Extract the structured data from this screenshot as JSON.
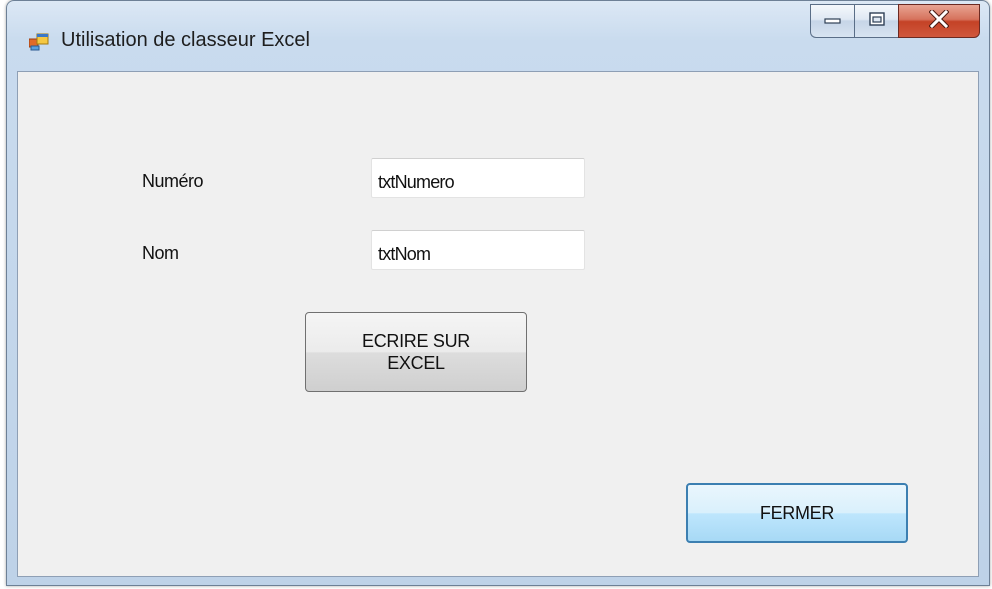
{
  "window": {
    "title": "Utilisation de classeur Excel",
    "icon": "windows-form-icon"
  },
  "caption_buttons": {
    "minimize_icon": "minimize-icon",
    "maximize_icon": "maximize-icon",
    "close_icon": "close-icon"
  },
  "form": {
    "numero_label": "Numéro",
    "numero_value": "txtNumero",
    "nom_label": "Nom",
    "nom_value": "txtNom",
    "write_button_label": "ECRIRE SUR\nEXCEL",
    "close_button_label": "FERMER"
  },
  "colors": {
    "client_background": "#f0f0f0",
    "close_button_red": "#c44226",
    "focus_border": "#3c7fb1"
  }
}
